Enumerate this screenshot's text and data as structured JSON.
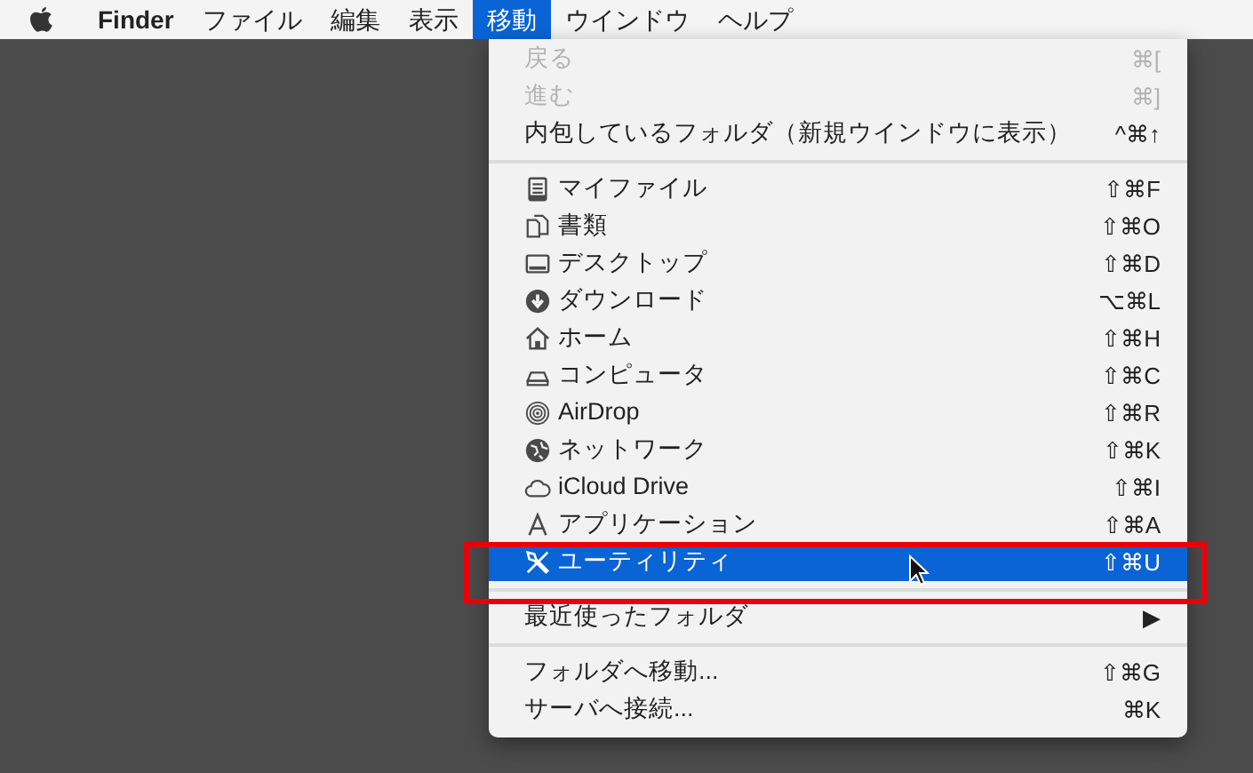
{
  "menubar": {
    "items": [
      {
        "label": "Finder",
        "selected": false,
        "kind": "app"
      },
      {
        "label": "ファイル",
        "selected": false,
        "kind": "menu"
      },
      {
        "label": "編集",
        "selected": false,
        "kind": "menu"
      },
      {
        "label": "表示",
        "selected": false,
        "kind": "menu"
      },
      {
        "label": "移動",
        "selected": true,
        "kind": "menu"
      },
      {
        "label": "ウインドウ",
        "selected": false,
        "kind": "menu"
      },
      {
        "label": "ヘルプ",
        "selected": false,
        "kind": "menu"
      }
    ]
  },
  "menu": {
    "sections": [
      {
        "items": [
          {
            "label": "戻る",
            "shortcut": "⌘[",
            "disabled": true,
            "selected": false
          },
          {
            "label": "進む",
            "shortcut": "⌘]",
            "disabled": true,
            "selected": false
          },
          {
            "label": "内包しているフォルダ（新規ウインドウに表示）",
            "shortcut": "^⌘↑",
            "disabled": false,
            "selected": false
          }
        ]
      },
      {
        "items": [
          {
            "label": "マイファイル",
            "shortcut": "⇧⌘F",
            "disabled": false,
            "selected": false
          },
          {
            "label": "書類",
            "shortcut": "⇧⌘O",
            "disabled": false,
            "selected": false
          },
          {
            "label": "デスクトップ",
            "shortcut": "⇧⌘D",
            "disabled": false,
            "selected": false
          },
          {
            "label": "ダウンロード",
            "shortcut": "⌥⌘L",
            "disabled": false,
            "selected": false
          },
          {
            "label": "ホーム",
            "shortcut": "⇧⌘H",
            "disabled": false,
            "selected": false
          },
          {
            "label": "コンピュータ",
            "shortcut": "⇧⌘C",
            "disabled": false,
            "selected": false
          },
          {
            "label": "AirDrop",
            "shortcut": "⇧⌘R",
            "disabled": false,
            "selected": false
          },
          {
            "label": "ネットワーク",
            "shortcut": "⇧⌘K",
            "disabled": false,
            "selected": false
          },
          {
            "label": "iCloud Drive",
            "shortcut": "⇧⌘I",
            "disabled": false,
            "selected": false
          },
          {
            "label": "アプリケーション",
            "shortcut": "⇧⌘A",
            "disabled": false,
            "selected": false
          },
          {
            "label": "ユーティリティ",
            "shortcut": "⇧⌘U",
            "disabled": false,
            "selected": true
          }
        ]
      },
      {
        "items": [
          {
            "label": "最近使ったフォルダ",
            "shortcut": "▶",
            "disabled": false,
            "selected": false
          }
        ]
      },
      {
        "items": [
          {
            "label": "フォルダへ移動...",
            "shortcut": "⇧⌘G",
            "disabled": false,
            "selected": false
          },
          {
            "label": "サーバへ接続...",
            "shortcut": "⌘K",
            "disabled": false,
            "selected": false
          }
        ]
      }
    ]
  }
}
